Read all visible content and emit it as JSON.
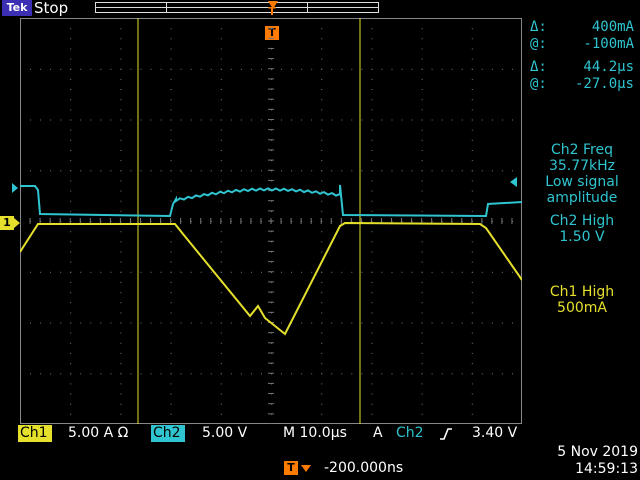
{
  "header": {
    "brand": "Tek",
    "status": "Stop",
    "trigger_marker": "T"
  },
  "channels": {
    "ch1_marker": "1",
    "ch1_color": "#e5e02b",
    "ch2_color": "#2fc4cf",
    "trigger_color": "#ff7a00"
  },
  "cursors": {
    "ampl_delta_symbol": "Δ:",
    "ampl_delta_value": "400mA",
    "ampl_at_symbol": "@:",
    "ampl_at_value": "-100mA",
    "time_delta_symbol": "Δ:",
    "time_delta_value": "44.2µs",
    "time_at_symbol": "@:",
    "time_at_value": "-27.0µs"
  },
  "measurements": {
    "ch2_freq_label": "Ch2 Freq",
    "ch2_freq_value": "35.77kHz",
    "ch2_freq_note_1": "Low signal",
    "ch2_freq_note_2": "amplitude",
    "ch2_high_label": "Ch2 High",
    "ch2_high_value": "1.50 V",
    "ch1_high_label": "Ch1 High",
    "ch1_high_value": "500mA"
  },
  "bottom_bar": {
    "ch1_label": "Ch1",
    "ch1_scale": "5.00 A Ω",
    "ch2_label": "Ch2",
    "ch2_scale": "5.00 V",
    "timebase": "M 10.0µs",
    "trigger_mode": "A",
    "trigger_source": "Ch2",
    "trigger_slope_icon": "rising-edge-icon",
    "trigger_level": "3.40 V",
    "horizontal_position": "-200.000ns",
    "date": "5 Nov 2019",
    "time": "14:59:13"
  }
}
